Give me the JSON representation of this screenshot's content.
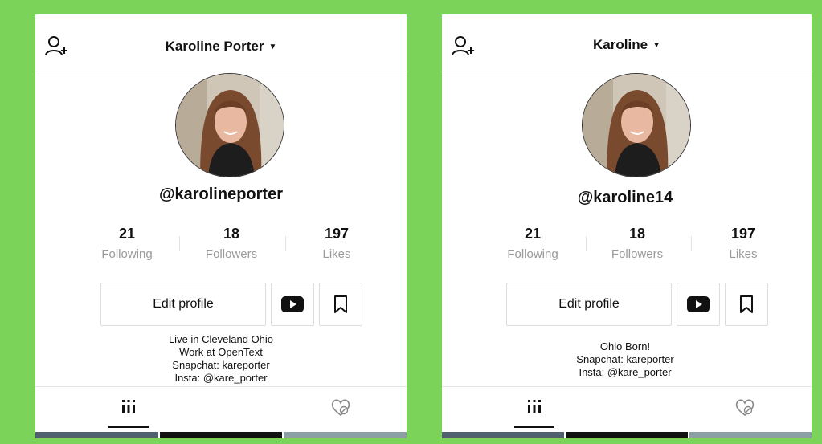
{
  "icons": {
    "add_user": "add-user-icon",
    "caret": "caret-down-icon",
    "youtube": "youtube-icon",
    "bookmark": "bookmark-icon",
    "grid": "grid-icon",
    "liked": "heart-hidden-icon"
  },
  "colors": {
    "frame": "#7bd35a",
    "text": "#111111",
    "muted": "#9a9a9a"
  },
  "profiles": [
    {
      "title": "Karoline Porter",
      "caret": "▼",
      "handle": "@karolineporter",
      "stats": {
        "following": {
          "value": "21",
          "label": "Following"
        },
        "followers": {
          "value": "18",
          "label": "Followers"
        },
        "likes": {
          "value": "197",
          "label": "Likes"
        }
      },
      "edit_label": "Edit profile",
      "bio": [
        "Live in Cleveland Ohio",
        "Work at OpenText",
        "Snapchat: kareporter",
        "Insta: @kare_porter"
      ]
    },
    {
      "title": "Karoline",
      "caret": "▼",
      "handle": "@karoline14",
      "stats": {
        "following": {
          "value": "21",
          "label": "Following"
        },
        "followers": {
          "value": "18",
          "label": "Followers"
        },
        "likes": {
          "value": "197",
          "label": "Likes"
        }
      },
      "edit_label": "Edit profile",
      "bio": [
        "Ohio Born!",
        "Snapchat: kareporter",
        "Insta: @kare_porter"
      ]
    }
  ]
}
